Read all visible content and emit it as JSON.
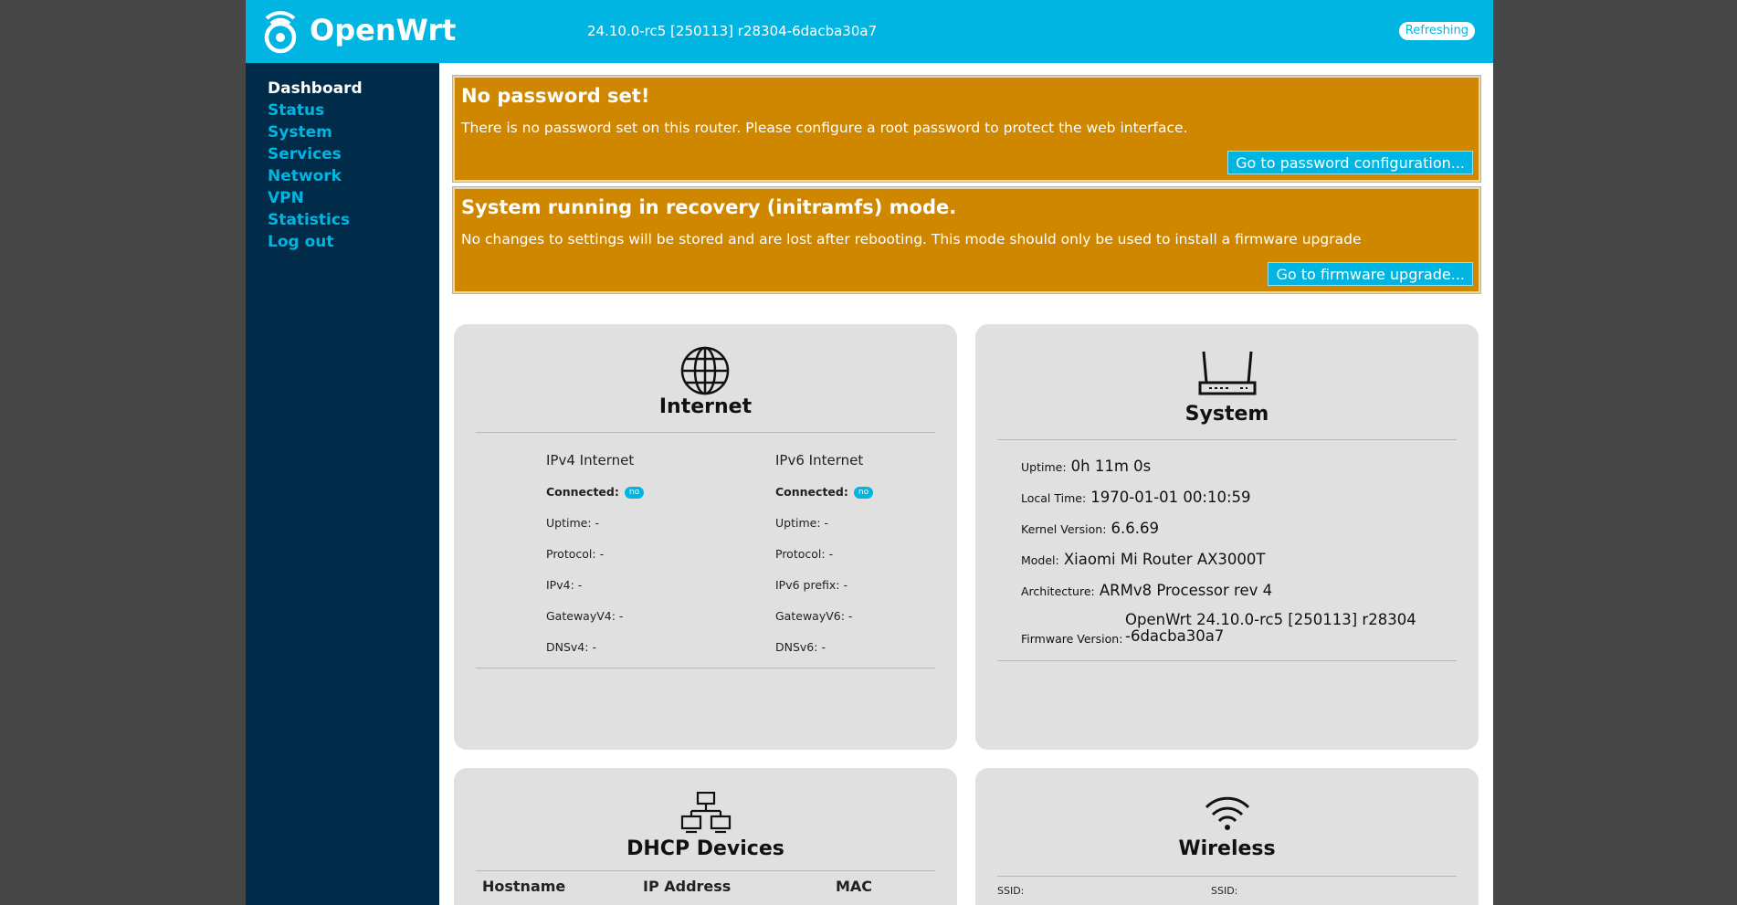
{
  "header": {
    "brand": "OpenWrt",
    "version": "24.10.0-rc5 [250113] r28304-6dacba30a7",
    "refresh_label": "Refreshing"
  },
  "sidebar": {
    "items": [
      {
        "label": "Dashboard",
        "active": true
      },
      {
        "label": "Status"
      },
      {
        "label": "System"
      },
      {
        "label": "Services"
      },
      {
        "label": "Network"
      },
      {
        "label": "VPN"
      },
      {
        "label": "Statistics"
      },
      {
        "label": "Log out"
      }
    ]
  },
  "alerts": [
    {
      "title": "No password set!",
      "text": "There is no password set on this router. Please configure a root password to protect the web interface.",
      "button": "Go to password configuration..."
    },
    {
      "title": "System running in recovery (initramfs) mode.",
      "text": "No changes to settings will be stored and are lost after rebooting. This mode should only be used to install a firmware upgrade",
      "button": "Go to firmware upgrade..."
    }
  ],
  "internet": {
    "title": "Internet",
    "ipv4": {
      "heading": "IPv4 Internet",
      "connected_label": "Connected:",
      "connected_value": "no",
      "uptime_label": "Uptime:",
      "uptime": "-",
      "protocol_label": "Protocol:",
      "protocol": "-",
      "addr_label": "IPv4:",
      "addr": "-",
      "gateway_label": "GatewayV4:",
      "gateway": "-",
      "dns_label": "DNSv4:",
      "dns": "-"
    },
    "ipv6": {
      "heading": "IPv6 Internet",
      "connected_label": "Connected:",
      "connected_value": "no",
      "uptime_label": "Uptime:",
      "uptime": "-",
      "protocol_label": "Protocol:",
      "protocol": "-",
      "addr_label": "IPv6 prefix:",
      "addr": "-",
      "gateway_label": "GatewayV6:",
      "gateway": "-",
      "dns_label": "DNSv6:",
      "dns": "-"
    }
  },
  "system": {
    "title": "System",
    "uptime_label": "Uptime:",
    "uptime": "0h 11m 0s",
    "localtime_label": "Local Time:",
    "localtime": "1970-01-01 00:10:59",
    "kernel_label": "Kernel Version:",
    "kernel": "6.6.69",
    "model_label": "Model:",
    "model": "Xiaomi Mi Router AX3000T",
    "arch_label": "Architecture:",
    "arch": "ARMv8 Processor rev 4",
    "firmware_label": "Firmware Version:",
    "firmware_line1": "OpenWrt 24.10.0-rc5 [250113] r28304",
    "firmware_line2": "-6dacba30a7"
  },
  "dhcp": {
    "title": "DHCP Devices",
    "columns": [
      "Hostname",
      "IP Address",
      "MAC"
    ]
  },
  "wireless": {
    "title": "Wireless",
    "ssid_label": "SSID:"
  },
  "colors": {
    "accent": "#00b5e2",
    "sidebar_bg": "#002b49",
    "alert_bg": "#d08700",
    "card_bg": "#e0e0e0"
  }
}
